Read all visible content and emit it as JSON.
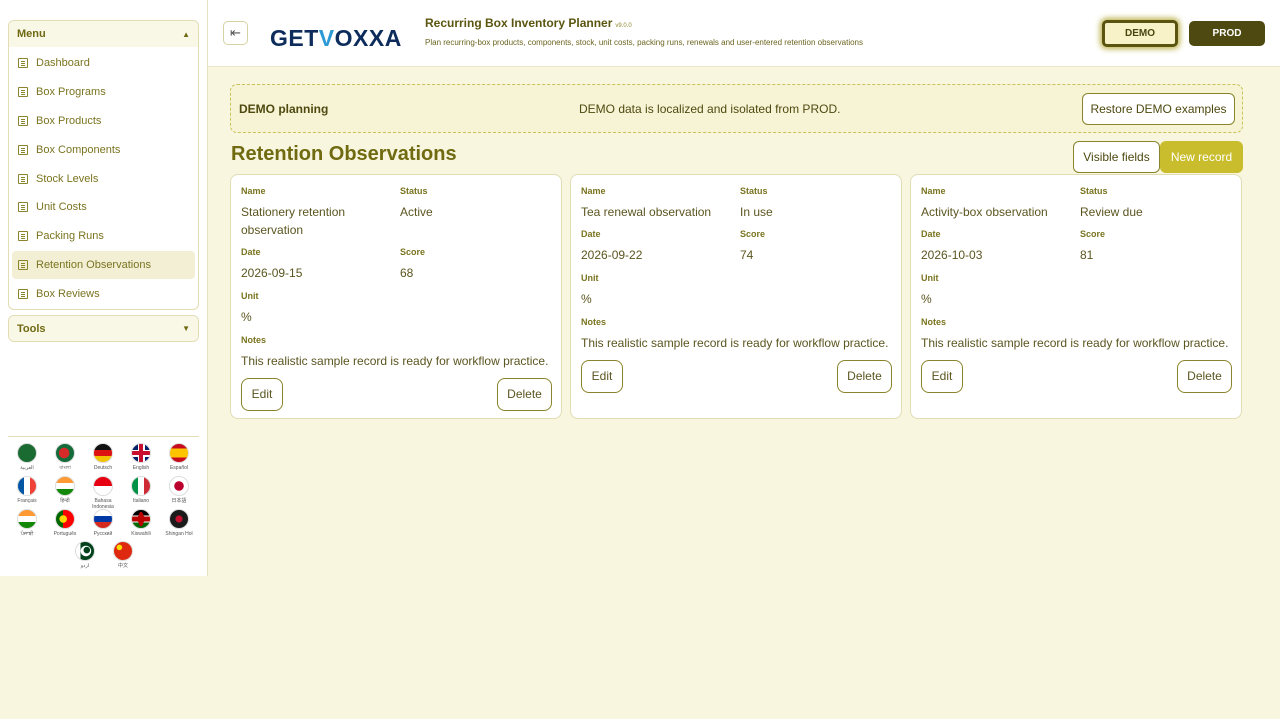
{
  "sidebar": {
    "menu_title": "Menu",
    "items": [
      {
        "label": "Dashboard",
        "active": false
      },
      {
        "label": "Box Programs",
        "active": false
      },
      {
        "label": "Box Products",
        "active": false
      },
      {
        "label": "Box Components",
        "active": false
      },
      {
        "label": "Stock Levels",
        "active": false
      },
      {
        "label": "Unit Costs",
        "active": false
      },
      {
        "label": "Packing Runs",
        "active": false
      },
      {
        "label": "Retention Observations",
        "active": true
      },
      {
        "label": "Box Reviews",
        "active": false
      }
    ],
    "tools_title": "Tools",
    "languages": [
      {
        "name": "العربية",
        "icon": "flag-saudi-arabia"
      },
      {
        "name": "বাংলা",
        "icon": "flag-bangladesh"
      },
      {
        "name": "Deutsch",
        "icon": "flag-germany"
      },
      {
        "name": "English",
        "icon": "flag-uk"
      },
      {
        "name": "Español",
        "icon": "flag-spain"
      },
      {
        "name": "Français",
        "icon": "flag-france"
      },
      {
        "name": "हिन्दी",
        "icon": "flag-india"
      },
      {
        "name": "Bahasa Indonesia",
        "icon": "flag-indonesia"
      },
      {
        "name": "Italiano",
        "icon": "flag-italy"
      },
      {
        "name": "日本語",
        "icon": "flag-japan"
      },
      {
        "name": "ਪੰਜਾਬੀ",
        "icon": "flag-india-punjabi"
      },
      {
        "name": "Português",
        "icon": "flag-portugal"
      },
      {
        "name": "Русский",
        "icon": "flag-russia"
      },
      {
        "name": "Kiswahili",
        "icon": "flag-kenya"
      },
      {
        "name": "Shingan Hol",
        "icon": "flag-shingan"
      },
      {
        "name": "اردو",
        "icon": "flag-pakistan"
      },
      {
        "name": "中文",
        "icon": "flag-china"
      }
    ]
  },
  "header": {
    "logo_left": "GET",
    "logo_v": "V",
    "logo_right": "OXXA",
    "app_title": "Recurring Box Inventory Planner",
    "version": "v9.0.0",
    "subtitle": "Plan recurring-box products, components, stock, unit costs, packing runs, renewals and user-entered retention observations",
    "demo_label": "DEMO",
    "prod_label": "PROD"
  },
  "banner": {
    "label": "DEMO planning",
    "text": "DEMO data is localized and isolated from PROD.",
    "restore_label": "Restore DEMO examples"
  },
  "main": {
    "title": "Retention Observations",
    "visible_fields_label": "Visible fields",
    "new_record_label": "New record",
    "field_labels": {
      "name": "Name",
      "status": "Status",
      "date": "Date",
      "score": "Score",
      "unit": "Unit",
      "notes": "Notes"
    },
    "edit_label": "Edit",
    "delete_label": "Delete",
    "records": [
      {
        "name": "Stationery retention observation",
        "status": "Active",
        "date": "2026-09-15",
        "score": "68",
        "unit": "%",
        "notes": "This realistic sample record is ready for workflow practice."
      },
      {
        "name": "Tea renewal observation",
        "status": "In use",
        "date": "2026-09-22",
        "score": "74",
        "unit": "%",
        "notes": "This realistic sample record is ready for workflow practice."
      },
      {
        "name": "Activity-box observation",
        "status": "Review due",
        "date": "2026-10-03",
        "score": "81",
        "unit": "%",
        "notes": "This realistic sample record is ready for workflow practice."
      }
    ]
  },
  "colors": {
    "accent": "#c9bd2e",
    "dark": "#4e4910",
    "background": "#f8f6df"
  }
}
